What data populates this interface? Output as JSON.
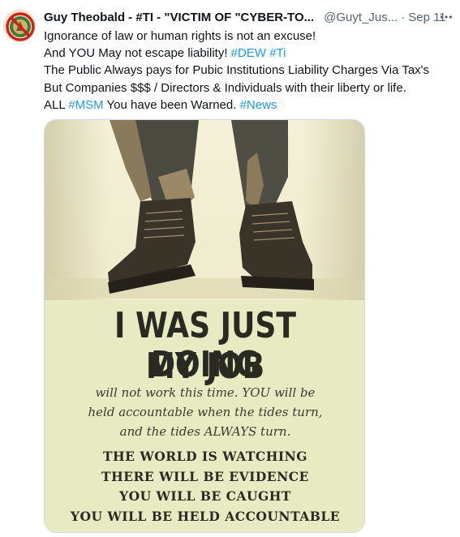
{
  "author": {
    "display_name": "Guy Theobald - #TI - \"VICTIM OF \"CYBER-TO...",
    "handle": "@Guyt_Jus...",
    "separator": "·",
    "time": "Sep 11",
    "avatar_icon": "no-symbol-seal-icon"
  },
  "more_icon": "more-horizontal-icon",
  "tweet": {
    "lines": [
      {
        "text": "Ignorance of law or human rights is not an excuse!"
      },
      {
        "text": "And YOU May not escape liability! ",
        "tags": [
          "#DEW",
          "#Ti"
        ]
      },
      {
        "text": "The Public Always pays for Pubic Institutions Liability Charges Via Tax's"
      },
      {
        "text": "But Companies $$$ / Directors & Individuals with their liberty or life."
      }
    ],
    "line5_pre": "ALL ",
    "line5_tag1": "#MSM",
    "line5_mid": " You have been Warned. ",
    "line5_tag2": "#News",
    "line2_tag_sep": " "
  },
  "media": {
    "heading_line1": "I WAS JUST DOING",
    "heading_line2": "MY JOB",
    "italic_line1": "will not work this time. YOU will be",
    "italic_line2": "held accountable when the tides turn,",
    "italic_line3": "and the tides ALWAYS turn.",
    "caps_line1": "THE WORLD IS WATCHING",
    "caps_line2": "THERE WILL BE EVIDENCE",
    "caps_line3": "YOU WILL BE CAUGHT",
    "caps_line4": "YOU WILL BE HELD ACCOUNTABLE"
  },
  "colors": {
    "link": "#1d9bf0",
    "secondary": "#536471",
    "text": "#0f1419",
    "image_bg": "#e8ebc4"
  }
}
